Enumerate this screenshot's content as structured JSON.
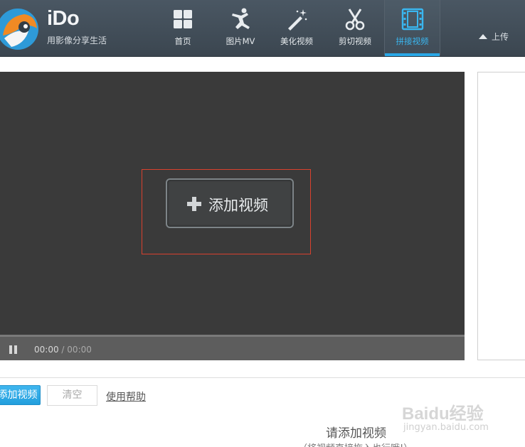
{
  "header": {
    "logo_text": "iDo",
    "tagline": "用影像分享生活",
    "nav": [
      {
        "label": "首页",
        "icon": "grid-icon"
      },
      {
        "label": "图片MV",
        "icon": "dancer-icon"
      },
      {
        "label": "美化视频",
        "icon": "magic-wand-icon"
      },
      {
        "label": "剪切视频",
        "icon": "scissors-icon"
      },
      {
        "label": "拼接视频",
        "icon": "film-strip-icon",
        "active": true
      }
    ],
    "upload_label": "上传"
  },
  "player": {
    "add_video_label": "添加视频",
    "current_time": "00:00",
    "separator": "/",
    "duration": "00:00"
  },
  "toolbar": {
    "add_label": "添加视频",
    "clear_label": "清空",
    "help_label": "使用帮助"
  },
  "empty_state": {
    "title": "请添加视频",
    "subtitle": "（将视频直接拖入也行哦!）"
  },
  "watermark": {
    "text": "Baidu经验",
    "url": "jingyan.baidu.com"
  },
  "colors": {
    "header_bg": "#424e59",
    "accent": "#29a7e6",
    "player_bg": "#3a3a3a",
    "highlight_border": "#d9412e"
  }
}
